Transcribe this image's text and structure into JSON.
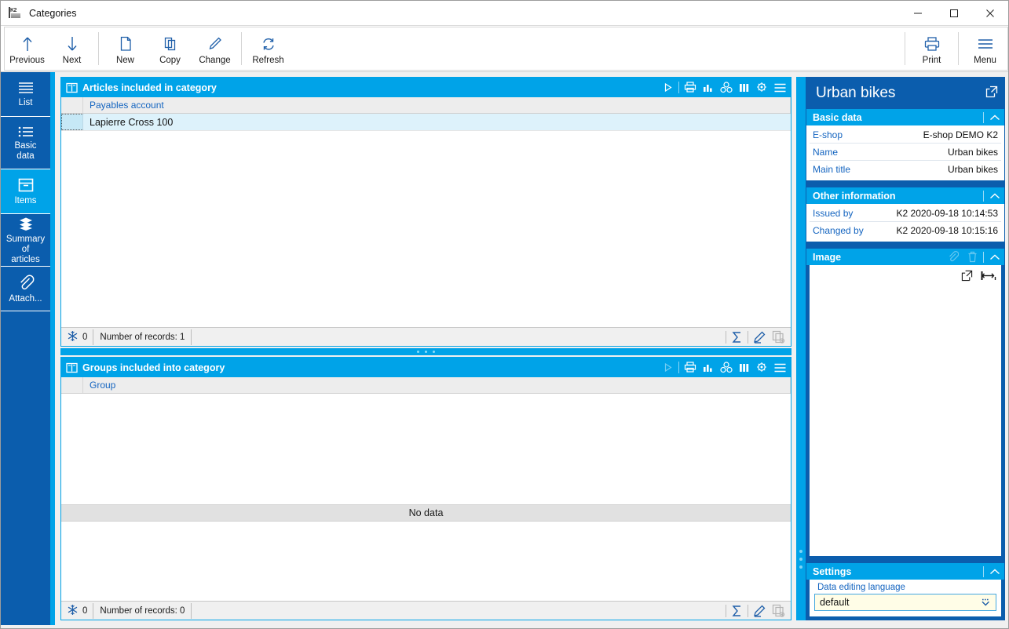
{
  "window": {
    "title": "Categories",
    "app_icon": "k2-logo-icon",
    "minimize_label": "Minimize",
    "maximize_label": "Maximize",
    "close_label": "Close"
  },
  "toolbar": {
    "buttons": [
      {
        "label": "Previous",
        "icon": "arrow-up-icon"
      },
      {
        "label": "Next",
        "icon": "arrow-down-icon"
      },
      {
        "label": "New",
        "icon": "new-document-icon"
      },
      {
        "label": "Copy",
        "icon": "copy-icon"
      },
      {
        "label": "Change",
        "icon": "pencil-icon"
      },
      {
        "label": "Refresh",
        "icon": "refresh-icon"
      }
    ],
    "right_buttons": [
      {
        "label": "Print",
        "icon": "printer-icon"
      },
      {
        "label": "Menu",
        "icon": "hamburger-icon"
      }
    ]
  },
  "sidebar": {
    "items": [
      {
        "label": "List",
        "icon": "list-lines-icon",
        "active": false
      },
      {
        "label": "Basic\ndata",
        "icon": "bulleted-list-icon",
        "active": false
      },
      {
        "label": "Items",
        "icon": "box-icon",
        "active": true
      },
      {
        "label": "Summary of articles",
        "icon": "stack-layers-icon",
        "active": false
      },
      {
        "label": "Attach...",
        "icon": "paperclip-icon",
        "active": false
      }
    ]
  },
  "panels": [
    {
      "title": "Articles included in category",
      "title_icon": "book-icon",
      "tools": [
        "run-icon",
        "print-icon",
        "chart-icon",
        "pivot-icon",
        "columns-icon",
        "settings-icon",
        "menu-icon"
      ],
      "run_enabled": true,
      "columns": [
        "Payables account"
      ],
      "rows": [
        {
          "cells": [
            "Lapierre Cross 100"
          ],
          "selected": true
        }
      ],
      "empty_text": "",
      "footer": {
        "filter_icon": "snowflake-icon",
        "filter_count": "0",
        "record_count_label": "Number of records: 1",
        "tools": [
          "sum-icon",
          "edit-icon",
          "copy-row-icon"
        ]
      }
    },
    {
      "title": "Groups included into category",
      "title_icon": "book-icon",
      "tools": [
        "run-icon",
        "print-icon",
        "chart-icon",
        "pivot-icon",
        "columns-icon",
        "settings-icon",
        "menu-icon"
      ],
      "run_enabled": false,
      "columns": [
        "Group"
      ],
      "rows": [],
      "empty_text": "No data",
      "footer": {
        "filter_icon": "snowflake-icon",
        "filter_count": "0",
        "record_count_label": "Number of records: 0",
        "tools": [
          "sum-icon",
          "edit-icon",
          "copy-row-icon"
        ]
      }
    }
  ],
  "detail": {
    "heading": "Urban bikes",
    "popout_icon": "external-link-icon",
    "sections": [
      {
        "title": "Basic data",
        "collapse_icon": "chevron-up-icon",
        "fields": [
          {
            "key": "E-shop",
            "value": "E-shop DEMO K2"
          },
          {
            "key": "Name",
            "value": "Urban bikes"
          },
          {
            "key": "Main title",
            "value": "Urban bikes"
          }
        ]
      },
      {
        "title": "Other information",
        "collapse_icon": "chevron-up-icon",
        "fields": [
          {
            "key": "Issued by",
            "value": "K2 2020-09-18 10:14:53"
          },
          {
            "key": "Changed by",
            "value": "K2 2020-09-18 10:15:16"
          }
        ]
      }
    ],
    "image_section": {
      "title": "Image",
      "attach_icon": "paperclip-icon",
      "delete_icon": "trash-icon",
      "collapse_icon": "chevron-up-icon",
      "body_tools": [
        "external-link-icon",
        "fit-width-icon"
      ]
    },
    "settings_section": {
      "title": "Settings",
      "collapse_icon": "chevron-up-icon",
      "field_label": "Data editing language",
      "field_value": "default",
      "dropdown_icon": "chevron-down-icon"
    }
  },
  "colors": {
    "accent_cyan": "#00a3e8",
    "accent_blue": "#0b5dad",
    "icon_blue": "#1f5fa9",
    "link_blue": "#1565c0",
    "row_selected": "#ddf2fb",
    "field_bg": "#fffde7"
  }
}
